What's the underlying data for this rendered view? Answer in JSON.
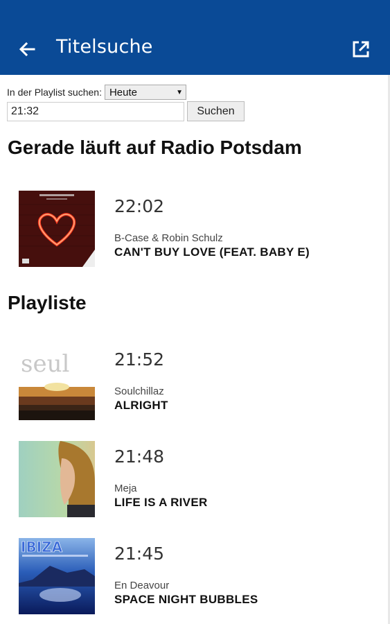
{
  "appbar": {
    "title": "Titelsuche",
    "back_icon": "arrow-left-icon",
    "open_icon": "open-external-icon",
    "color": "#0a4a96"
  },
  "search": {
    "label": "In der Playlist suchen:",
    "day_selected": "Heute",
    "time_value": "21:32",
    "button_label": "Suchen"
  },
  "now_playing": {
    "heading": "Gerade läuft auf Radio Potsdam",
    "track": {
      "time": "22:02",
      "artist": "B-Case & Robin Schulz",
      "title": "CAN'T BUY LOVE (FEAT. BABY E)"
    }
  },
  "playlist": {
    "heading": "Playliste",
    "items": [
      {
        "time": "21:52",
        "artist": "Soulchillaz",
        "title": "ALRIGHT"
      },
      {
        "time": "21:48",
        "artist": "Meja",
        "title": "LIFE IS A RIVER"
      },
      {
        "time": "21:45",
        "artist": "En Deavour",
        "title": "SPACE NIGHT BUBBLES"
      }
    ]
  }
}
